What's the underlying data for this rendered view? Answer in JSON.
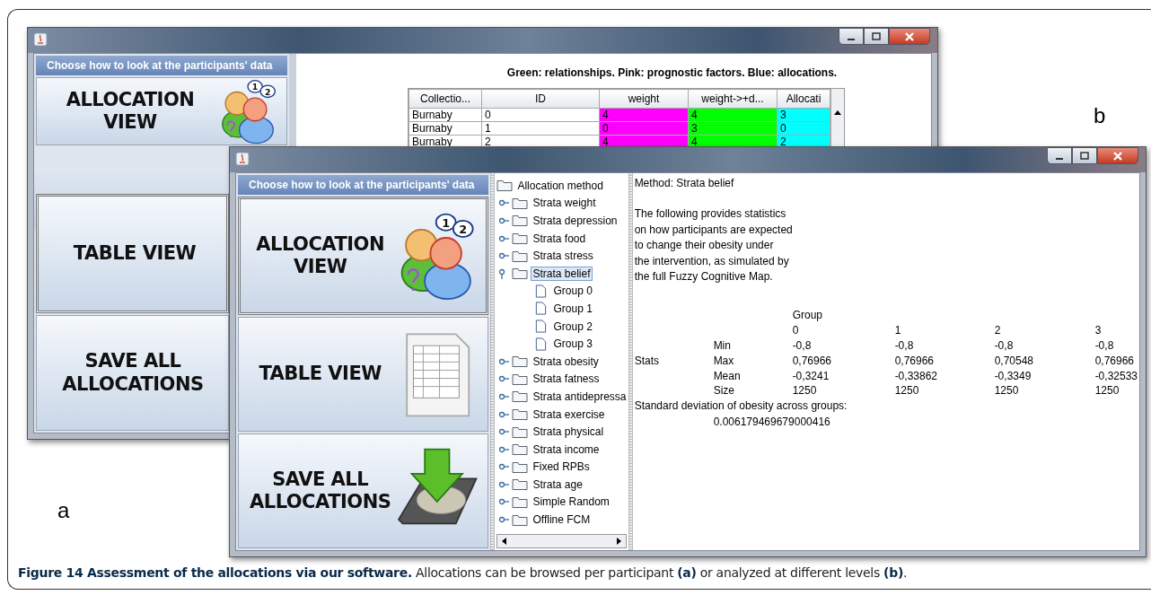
{
  "window_a": {
    "label": "a",
    "header": "Choose how to look at the participants' data",
    "views": [
      {
        "kind": "allocation",
        "lines": [
          "ALLOCATION",
          "VIEW"
        ],
        "selected": false,
        "bubble_numbers": [
          "1",
          "2"
        ]
      },
      {
        "lines": [
          "TABLE VIEW"
        ],
        "selected": true
      },
      {
        "lines": [
          "SAVE ALL",
          "ALLOCATIONS"
        ],
        "selected": false
      }
    ],
    "legend": "Green: relationships. Pink: prognostic factors. Blue: allocations.",
    "table": {
      "columns": [
        {
          "label": "Collectio..."
        },
        {
          "label": "ID"
        },
        {
          "label": "weight",
          "color": "#ff00ff"
        },
        {
          "label": "weight->+d...",
          "color": "#00ff00"
        },
        {
          "label": "Allocati",
          "color": "#00ffff"
        }
      ],
      "rows": [
        {
          "cells": [
            "Burnaby",
            "0",
            "4",
            "4",
            "3"
          ]
        },
        {
          "cells": [
            "Burnaby",
            "1",
            "0",
            "3",
            "0"
          ]
        },
        {
          "cells": [
            "Burnaby",
            "2",
            "4",
            "4",
            "2"
          ]
        }
      ]
    }
  },
  "window_b": {
    "label": "b",
    "header": "Choose how to look at the participants' data",
    "views": [
      {
        "kind": "allocation",
        "lines": [
          "ALLOCATION",
          "VIEW"
        ],
        "selected": true,
        "bubble_numbers": [
          "1",
          "2"
        ]
      },
      {
        "kind": "table",
        "lines": [
          "TABLE VIEW"
        ],
        "selected": false
      },
      {
        "kind": "save",
        "lines": [
          "SAVE ALL",
          "ALLOCATIONS"
        ],
        "selected": false
      }
    ],
    "tree": {
      "label": "Allocation method",
      "kind": "folder",
      "expanded": true,
      "selected": false,
      "children": [
        {
          "label": "Strata weight",
          "kind": "folder",
          "expanded": false,
          "selected": false
        },
        {
          "label": "Strata depression",
          "kind": "folder",
          "expanded": false,
          "selected": false
        },
        {
          "label": "Strata food",
          "kind": "folder",
          "expanded": false,
          "selected": false
        },
        {
          "label": "Strata stress",
          "kind": "folder",
          "expanded": false,
          "selected": false
        },
        {
          "label": "Strata belief",
          "kind": "folder",
          "expanded": true,
          "selected": true,
          "children": [
            {
              "label": "Group 0",
              "kind": "file",
              "selected": false
            },
            {
              "label": "Group 1",
              "kind": "file",
              "selected": false
            },
            {
              "label": "Group 2",
              "kind": "file",
              "selected": false
            },
            {
              "label": "Group 3",
              "kind": "file",
              "selected": false
            }
          ]
        },
        {
          "label": "Strata obesity",
          "kind": "folder",
          "expanded": false,
          "selected": false
        },
        {
          "label": "Strata fatness",
          "kind": "folder",
          "expanded": false,
          "selected": false
        },
        {
          "label": "Strata antidepressa",
          "kind": "folder",
          "expanded": false,
          "selected": false
        },
        {
          "label": "Strata exercise",
          "kind": "folder",
          "expanded": false,
          "selected": false
        },
        {
          "label": "Strata physical",
          "kind": "folder",
          "expanded": false,
          "selected": false
        },
        {
          "label": "Strata income",
          "kind": "folder",
          "expanded": false,
          "selected": false
        },
        {
          "label": "Fixed RPBs",
          "kind": "folder",
          "expanded": false,
          "selected": false
        },
        {
          "label": "Strata age",
          "kind": "folder",
          "expanded": false,
          "selected": false
        },
        {
          "label": "Simple Random",
          "kind": "folder",
          "expanded": false,
          "selected": false
        },
        {
          "label": "Offline FCM",
          "kind": "folder",
          "expanded": false,
          "selected": false
        }
      ]
    },
    "method": "Method: Strata belief",
    "description": "The following provides statistics\non how participants are expected\nto change their obesity under\nthe intervention, as simulated by\nthe full Fuzzy Cognitive Map.",
    "stats": {
      "group_heading": "Group",
      "side_label": "Stats",
      "groups": [
        "0",
        "1",
        "2",
        "3"
      ],
      "rows": [
        {
          "label": "Min",
          "values": [
            "-0,8",
            "-0,8",
            "-0,8",
            "-0,8"
          ]
        },
        {
          "label": "Max",
          "values": [
            "0,76966",
            "0,76966",
            "0,70548",
            "0,76966"
          ]
        },
        {
          "label": "Mean",
          "values": [
            "-0,3241",
            "-0,33862",
            "-0,3349",
            "-0,32533"
          ]
        },
        {
          "label": "Size",
          "values": [
            "1250",
            "1250",
            "1250",
            "1250"
          ]
        }
      ]
    },
    "std_label": "Standard deviation of obesity across groups:",
    "std_value": "0.006179469679000416"
  },
  "caption": "**Figure 14 Assessment of the allocations via our software.** Allocations can be browsed per participant **(a)** or analyzed at different levels **(b)**."
}
